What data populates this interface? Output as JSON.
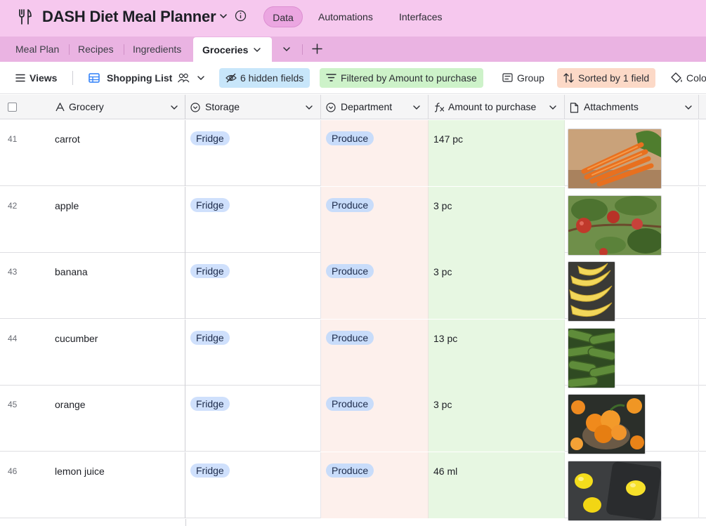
{
  "app": {
    "title": "DASH Diet Meal Planner",
    "logo_icon": "fork-knife-icon",
    "nav": {
      "data": "Data",
      "automations": "Automations",
      "interfaces": "Interfaces"
    }
  },
  "tabs": [
    {
      "label": "Meal Plan"
    },
    {
      "label": "Recipes"
    },
    {
      "label": "Ingredients"
    },
    {
      "label": "Groceries",
      "active": true
    }
  ],
  "toolbar": {
    "views": "Views",
    "view_name": "Shopping List",
    "hidden_fields": "6 hidden fields",
    "filter": "Filtered by Amount to purchase",
    "group": "Group",
    "sort": "Sorted by 1 field",
    "color": "Color"
  },
  "colors": {
    "hidden_fields_bg": "#c8e6fa",
    "filter_bg": "#cdf2c9",
    "sort_bg": "#fcd9c7",
    "department_col_bg": "#fdf0ec",
    "amount_col_bg": "#e7f7e2"
  },
  "columns": {
    "grocery": "Grocery",
    "storage": "Storage",
    "department": "Department",
    "amount": "Amount to purchase",
    "attachments": "Attachments"
  },
  "rows": [
    {
      "num": "41",
      "grocery": "carrot",
      "storage": "Fridge",
      "department": "Produce",
      "amount": "147 pc",
      "attachment": "carrot-photo"
    },
    {
      "num": "42",
      "grocery": "apple",
      "storage": "Fridge",
      "department": "Produce",
      "amount": "3 pc",
      "attachment": "apple-photo"
    },
    {
      "num": "43",
      "grocery": "banana",
      "storage": "Fridge",
      "department": "Produce",
      "amount": "3 pc",
      "attachment": "banana-photo"
    },
    {
      "num": "44",
      "grocery": "cucumber",
      "storage": "Fridge",
      "department": "Produce",
      "amount": "13 pc",
      "attachment": "cucumber-photo"
    },
    {
      "num": "45",
      "grocery": "orange",
      "storage": "Fridge",
      "department": "Produce",
      "amount": "3 pc",
      "attachment": "orange-photo"
    },
    {
      "num": "46",
      "grocery": "lemon juice",
      "storage": "Fridge",
      "department": "Produce",
      "amount": "46 ml",
      "attachment": "lemon-photo"
    }
  ]
}
